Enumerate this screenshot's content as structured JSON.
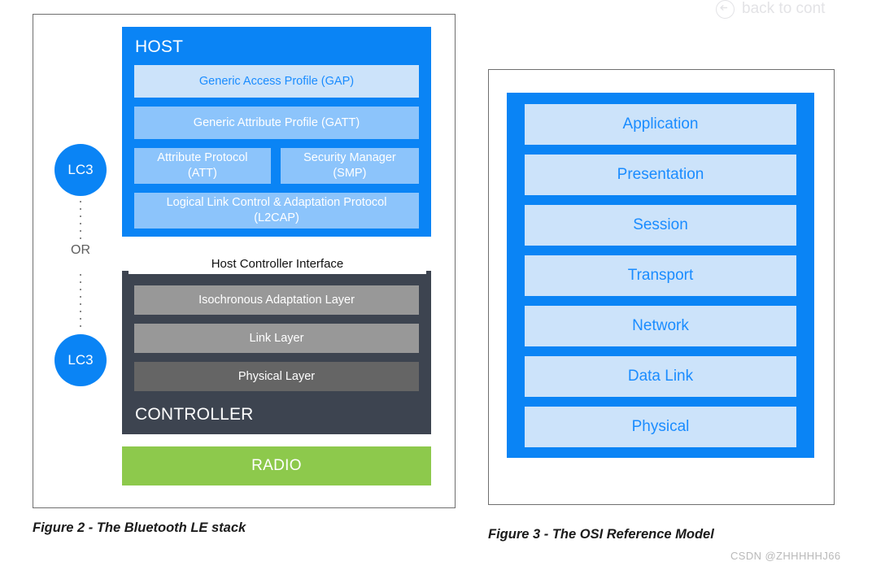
{
  "top_bar": {
    "back_link_label": "back to cont",
    "back_icon": "back-arrow-circle-icon"
  },
  "figure_left": {
    "caption": "Figure 2 - The Bluetooth LE stack",
    "codec": {
      "top_label": "LC3",
      "bottom_label": "LC3",
      "connector_label": "OR"
    },
    "host": {
      "title": "HOST",
      "layers": [
        {
          "label": "Generic Access Profile (GAP)",
          "style": "pale"
        },
        {
          "label": "Generic Attribute Profile (GATT)",
          "style": "medium"
        },
        {
          "label": "Attribute Protocol\n(ATT)",
          "line1": "Attribute Protocol",
          "line2": "(ATT)",
          "style": "medium"
        },
        {
          "label": "Security Manager\n(SMP)",
          "line1": "Security Manager",
          "line2": "(SMP)",
          "style": "medium"
        },
        {
          "label": "Logical Link Control & Adaptation Protocol\n(L2CAP)",
          "line1": "Logical Link Control & Adaptation Protocol",
          "line2": "(L2CAP)",
          "style": "medium"
        }
      ]
    },
    "hci": {
      "label": "Host Controller Interface"
    },
    "controller": {
      "title": "CONTROLLER",
      "layers": [
        {
          "label": "Isochronous Adaptation Layer",
          "style": "gray"
        },
        {
          "label": "Link Layer",
          "style": "gray"
        },
        {
          "label": "Physical Layer",
          "style": "gray-dark"
        }
      ]
    },
    "radio": {
      "label": "RADIO"
    }
  },
  "figure_right": {
    "caption": "Figure 3 - The OSI Reference Model",
    "layers": [
      {
        "label": "Application"
      },
      {
        "label": "Presentation"
      },
      {
        "label": "Session"
      },
      {
        "label": "Transport"
      },
      {
        "label": "Network"
      },
      {
        "label": "Data Link"
      },
      {
        "label": "Physical"
      }
    ]
  },
  "watermark": {
    "text": "CSDN @ZHHHHHJ66"
  },
  "colors": {
    "brand_blue": "#0a84f5",
    "pale_blue": "#cce3fa",
    "medium_blue": "#8cc4fb",
    "blue_text": "#1a8cff",
    "controller_dark": "#3d4450",
    "gray_layer": "#989898",
    "gray_layer_dark": "#656565",
    "radio_green": "#8dc94c"
  }
}
